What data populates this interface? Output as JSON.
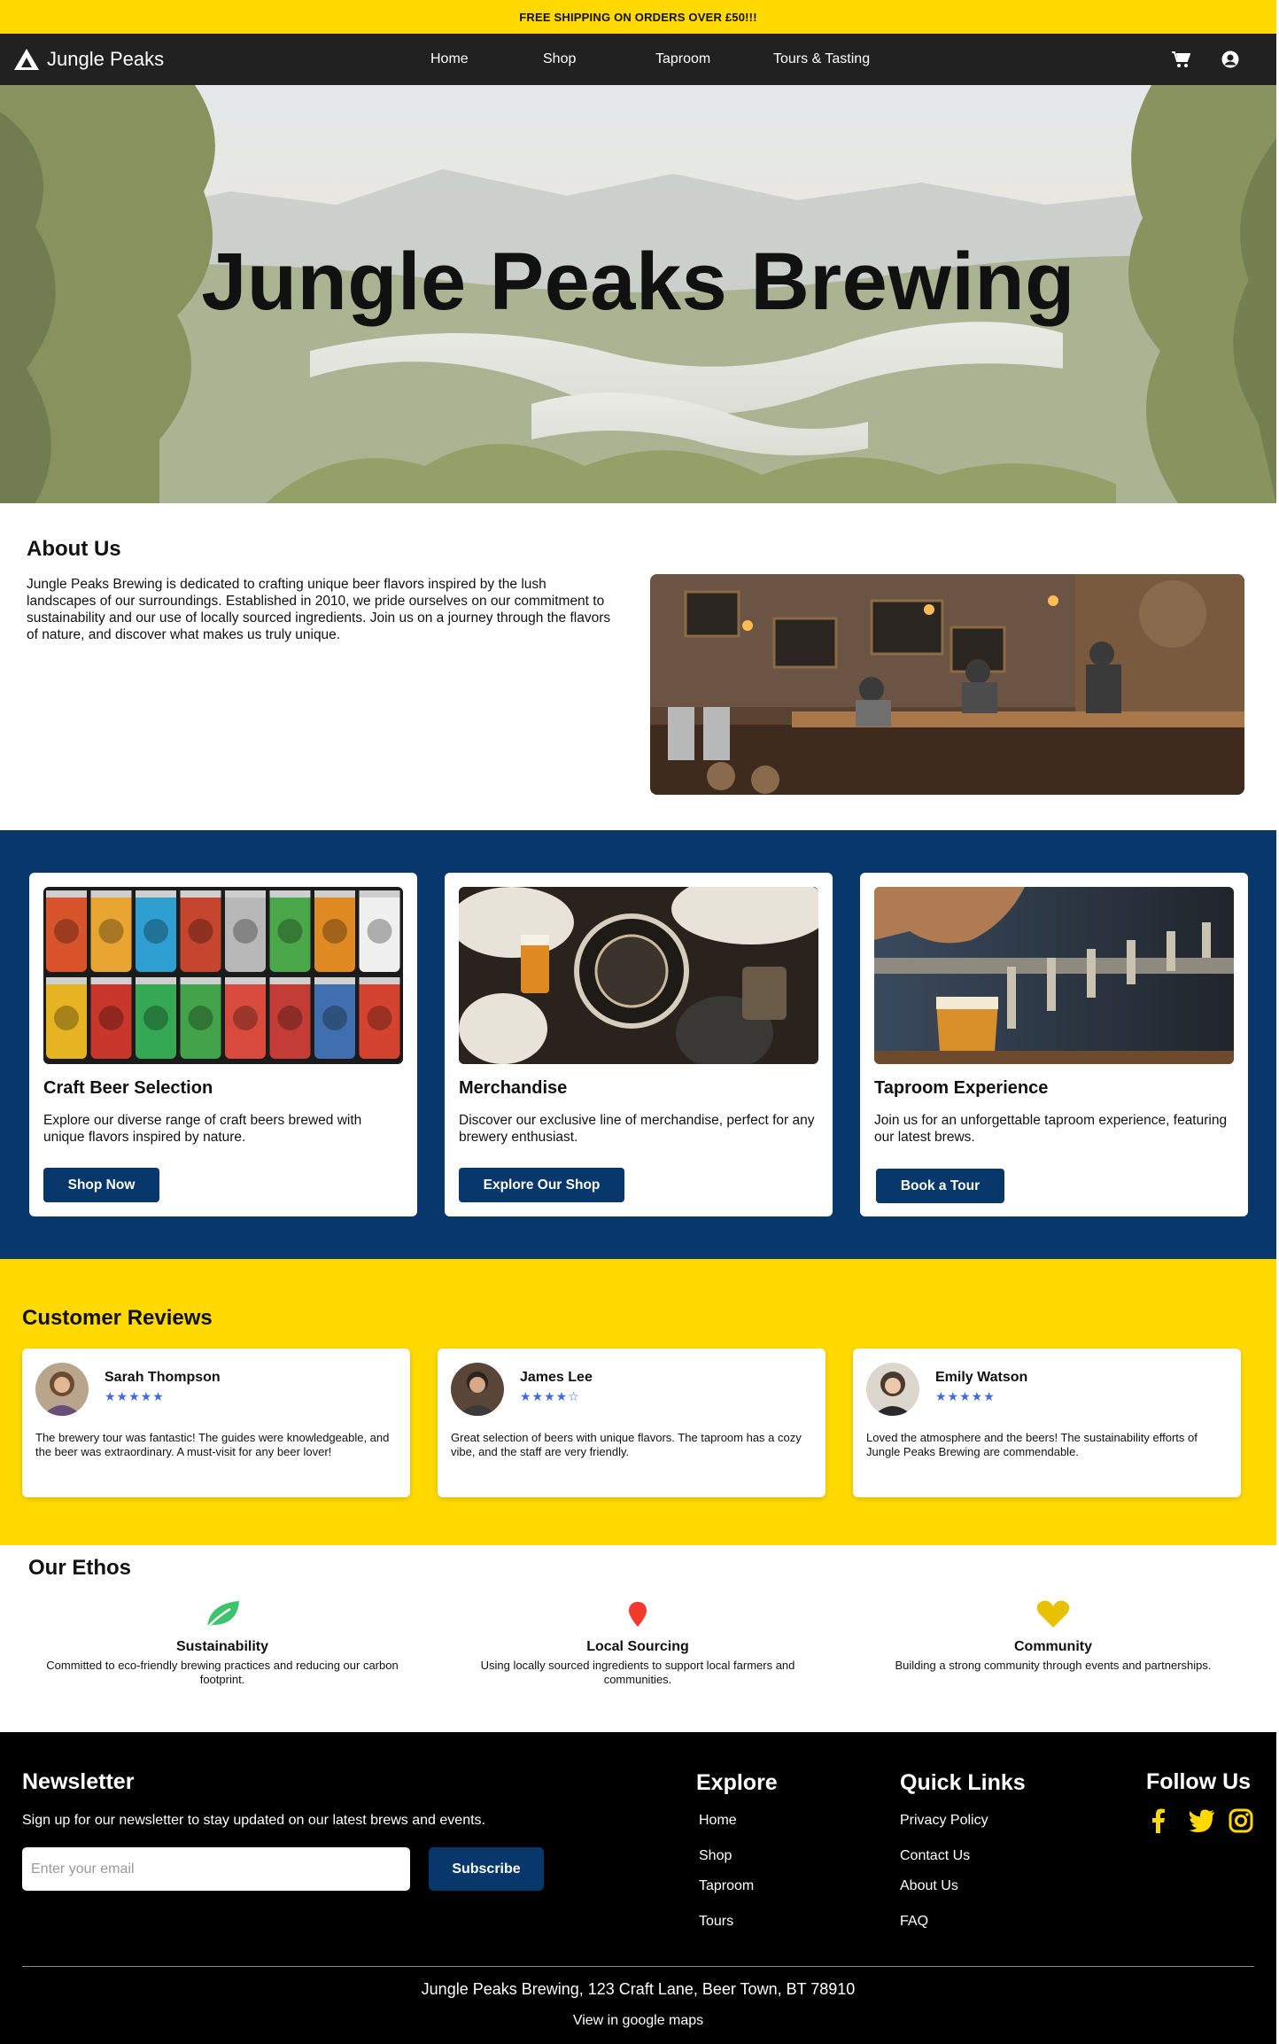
{
  "announcement": "FREE SHIPPING ON ORDERS OVER £50!!!",
  "brand": {
    "name": "Jungle Peaks"
  },
  "nav": {
    "links": [
      "Home",
      "Shop",
      "Taproom",
      "Tours & Tasting"
    ],
    "icons": [
      "cart-icon",
      "user-account-icon"
    ]
  },
  "hero": {
    "title": "Jungle Peaks Brewing"
  },
  "about": {
    "title": "About Us",
    "text": "Jungle Peaks Brewing is dedicated to crafting unique beer flavors inspired by the lush landscapes of our surroundings. Established in 2010, we pride ourselves on our commitment to sustainability and our use of locally sourced ingredients. Join us on a journey through the flavors of nature, and discover what makes us truly unique."
  },
  "features": [
    {
      "title": "Craft Beer Selection",
      "text": "Explore our diverse range of craft beers brewed with unique flavors inspired by nature.",
      "button": "Shop Now"
    },
    {
      "title": "Merchandise",
      "text": "Discover our exclusive line of merchandise, perfect for any brewery enthusiast.",
      "button": "Explore Our Shop"
    },
    {
      "title": "Taproom Experience",
      "text": "Join us for an unforgettable taproom experience, featuring our latest brews.",
      "button": "Book a Tour"
    }
  ],
  "reviews": {
    "title": "Customer Reviews",
    "items": [
      {
        "name": "Sarah Thompson",
        "stars": "★★★★★",
        "rating": 5,
        "text": "The brewery tour was fantastic! The guides were knowledgeable, and the beer was extraordinary. A must-visit for any beer lover!"
      },
      {
        "name": "James Lee",
        "stars": "★★★★☆",
        "rating": 4,
        "text": "Great selection of beers with unique flavors. The taproom has a cozy vibe, and the staff are very friendly."
      },
      {
        "name": "Emily Watson",
        "stars": "★★★★★",
        "rating": 5,
        "text": "Loved the atmosphere and the beers! The sustainability efforts of Jungle Peaks Brewing are commendable."
      }
    ]
  },
  "ethos": {
    "title": "Our Ethos",
    "items": [
      {
        "name": "Sustainability",
        "desc": "Committed to eco-friendly brewing practices and reducing our carbon footprint.",
        "icon": "leaf-icon"
      },
      {
        "name": "Local Sourcing",
        "desc": "Using locally sourced ingredients to support local farmers and communities.",
        "icon": "map-pin-icon"
      },
      {
        "name": "Community",
        "desc": "Building a strong community through events and partnerships.",
        "icon": "heart-icon"
      }
    ]
  },
  "footer": {
    "newsletter": {
      "title": "Newsletter",
      "text": "Sign up for our newsletter to stay updated on our latest brews and events.",
      "placeholder": "Enter your email",
      "button": "Subscribe"
    },
    "explore": {
      "title": "Explore",
      "links": [
        "Home",
        "Shop",
        "Taproom",
        "Tours"
      ]
    },
    "quick_links": {
      "title": "Quick Links",
      "links": [
        "Privacy Policy",
        "Contact Us",
        "About Us",
        "FAQ"
      ]
    },
    "follow": {
      "title": "Follow Us",
      "icons": [
        "facebook-icon",
        "twitter-icon",
        "instagram-icon"
      ]
    },
    "address": "Jungle Peaks Brewing, 123 Craft Lane, Beer Town, BT 78910",
    "maps_link": "View in google maps"
  },
  "colors": {
    "yellow": "#FFD900",
    "navy": "#07376B",
    "nav_bg": "#212121",
    "footer_bg": "#000000",
    "star_blue": "#4169E1"
  }
}
